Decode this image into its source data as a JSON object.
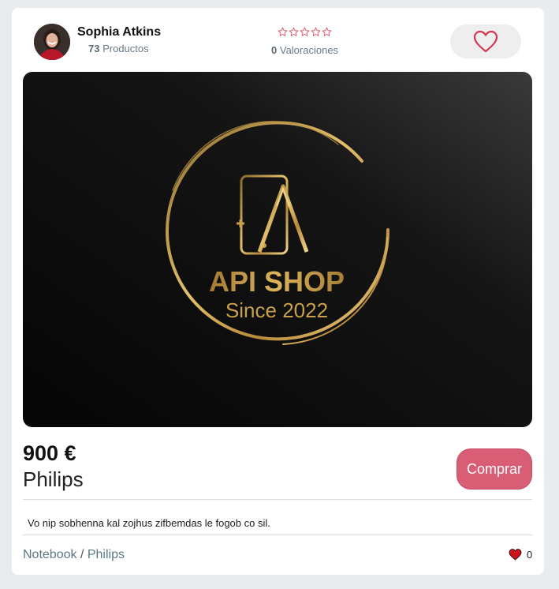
{
  "seller": {
    "name": "Sophia Atkins",
    "products_count": "73",
    "products_label": "Productos"
  },
  "rating": {
    "stars": 0,
    "max_stars": 5,
    "count": "0",
    "label": "Valoraciones",
    "star_color": "#d95d74"
  },
  "favorite": {
    "icon": "heart-outline-icon",
    "color": "#d0364f"
  },
  "image": {
    "line1": "API SHOP",
    "line2": "Since 2022",
    "gold": "#c9a14a"
  },
  "product": {
    "price": "900 €",
    "brand": "Philips",
    "buy_label": "Comprar",
    "description": "Vo nip sobhenna kal zojhus zifbemdas le fogob co sil."
  },
  "breadcrumb": {
    "category": "Notebook",
    "separator": "/",
    "subcategory": "Philips"
  },
  "likes": {
    "count": "0",
    "icon": "heart-filled-icon",
    "color": "#d0101d"
  }
}
